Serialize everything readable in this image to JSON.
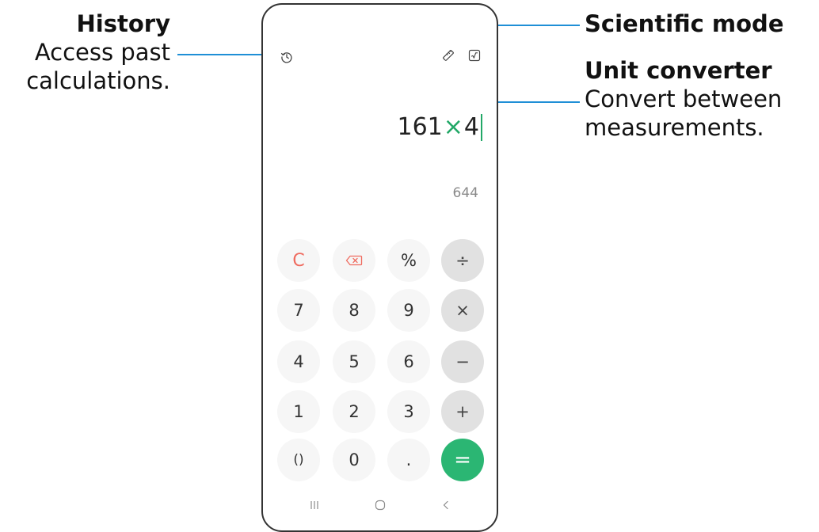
{
  "callouts": {
    "history": {
      "title": "History",
      "description_line1": "Access past",
      "description_line2": "calculations."
    },
    "scientific_mode": {
      "title": "Scientific mode"
    },
    "unit_converter": {
      "title": "Unit converter",
      "description_line1": "Convert between",
      "description_line2": "measurements."
    },
    "leader_color": "#1f8fd6"
  },
  "calculator": {
    "top_icons": {
      "history": "clock-history-icon",
      "unit_converter": "ruler-icon",
      "scientific_mode": "square-root-icon"
    },
    "expression": {
      "left": "161",
      "operator": "×",
      "right": "4"
    },
    "result": "644",
    "keys": [
      {
        "label": "C",
        "name": "clear-key",
        "type": "clear"
      },
      {
        "label": "",
        "name": "backspace-key",
        "type": "backspace"
      },
      {
        "label": "%",
        "name": "percent-key",
        "type": "digit"
      },
      {
        "label": "÷",
        "name": "divide-key",
        "type": "op"
      },
      {
        "label": "7",
        "name": "key-7",
        "type": "digit"
      },
      {
        "label": "8",
        "name": "key-8",
        "type": "digit"
      },
      {
        "label": "9",
        "name": "key-9",
        "type": "digit"
      },
      {
        "label": "×",
        "name": "multiply-key",
        "type": "op"
      },
      {
        "label": "4",
        "name": "key-4",
        "type": "digit"
      },
      {
        "label": "5",
        "name": "key-5",
        "type": "digit"
      },
      {
        "label": "6",
        "name": "key-6",
        "type": "digit"
      },
      {
        "label": "−",
        "name": "minus-key",
        "type": "op"
      },
      {
        "label": "1",
        "name": "key-1",
        "type": "digit"
      },
      {
        "label": "2",
        "name": "key-2",
        "type": "digit"
      },
      {
        "label": "3",
        "name": "key-3",
        "type": "digit"
      },
      {
        "label": "+",
        "name": "plus-key",
        "type": "op"
      },
      {
        "label": "()",
        "name": "parentheses-key",
        "type": "small"
      },
      {
        "label": "0",
        "name": "key-0",
        "type": "digit"
      },
      {
        "label": ".",
        "name": "decimal-key",
        "type": "digit"
      },
      {
        "label": "=",
        "name": "equals-key",
        "type": "equals"
      }
    ],
    "nav": {
      "recents": "recents-icon",
      "home": "home-icon",
      "back": "back-icon"
    },
    "colors": {
      "accent_green": "#2bb673",
      "clear_red": "#ef6b5f",
      "key_bg": "#f6f6f6",
      "op_key_bg": "#e1e1e1"
    }
  }
}
